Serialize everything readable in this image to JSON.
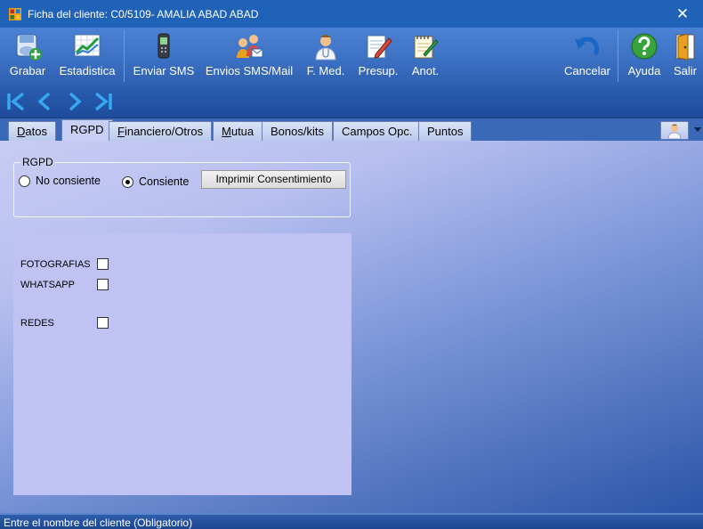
{
  "window": {
    "title": "Ficha del cliente: C0/5109- AMALIA ABAD ABAD",
    "close": "✕"
  },
  "toolbar": {
    "grabar": "Grabar",
    "estadistica": "Estadistica",
    "enviar_sms": "Enviar SMS",
    "envios_sms_mail": "Envios SMS/Mail",
    "f_med": "F. Med.",
    "presup": "Presup.",
    "anot": "Anot.",
    "cancelar": "Cancelar",
    "ayuda": "Ayuda",
    "salir": "Salir"
  },
  "tabs": {
    "datos_pre": "",
    "datos_u": "D",
    "datos_post": "atos",
    "rgpd": "RGPD",
    "financiero_u": "F",
    "financiero_post": "inanciero/Otros",
    "mutua_u": "M",
    "mutua_post": "utua",
    "bonos": "Bonos/kits",
    "campos": "Campos Opc.",
    "puntos": "Puntos"
  },
  "rgpd": {
    "legend": "RGPD",
    "no_consiente": "No consiente",
    "consiente": "Consiente",
    "selected": "Consiente",
    "print_button": "Imprimir Consentimiento"
  },
  "consents": [
    {
      "label": "FOTOGRAFIAS",
      "checked": false
    },
    {
      "label": "WHATSAPP",
      "checked": false
    },
    {
      "label": "REDES",
      "checked": false
    }
  ],
  "status": {
    "text": "Entre el nombre del cliente (Obligatorio)"
  }
}
